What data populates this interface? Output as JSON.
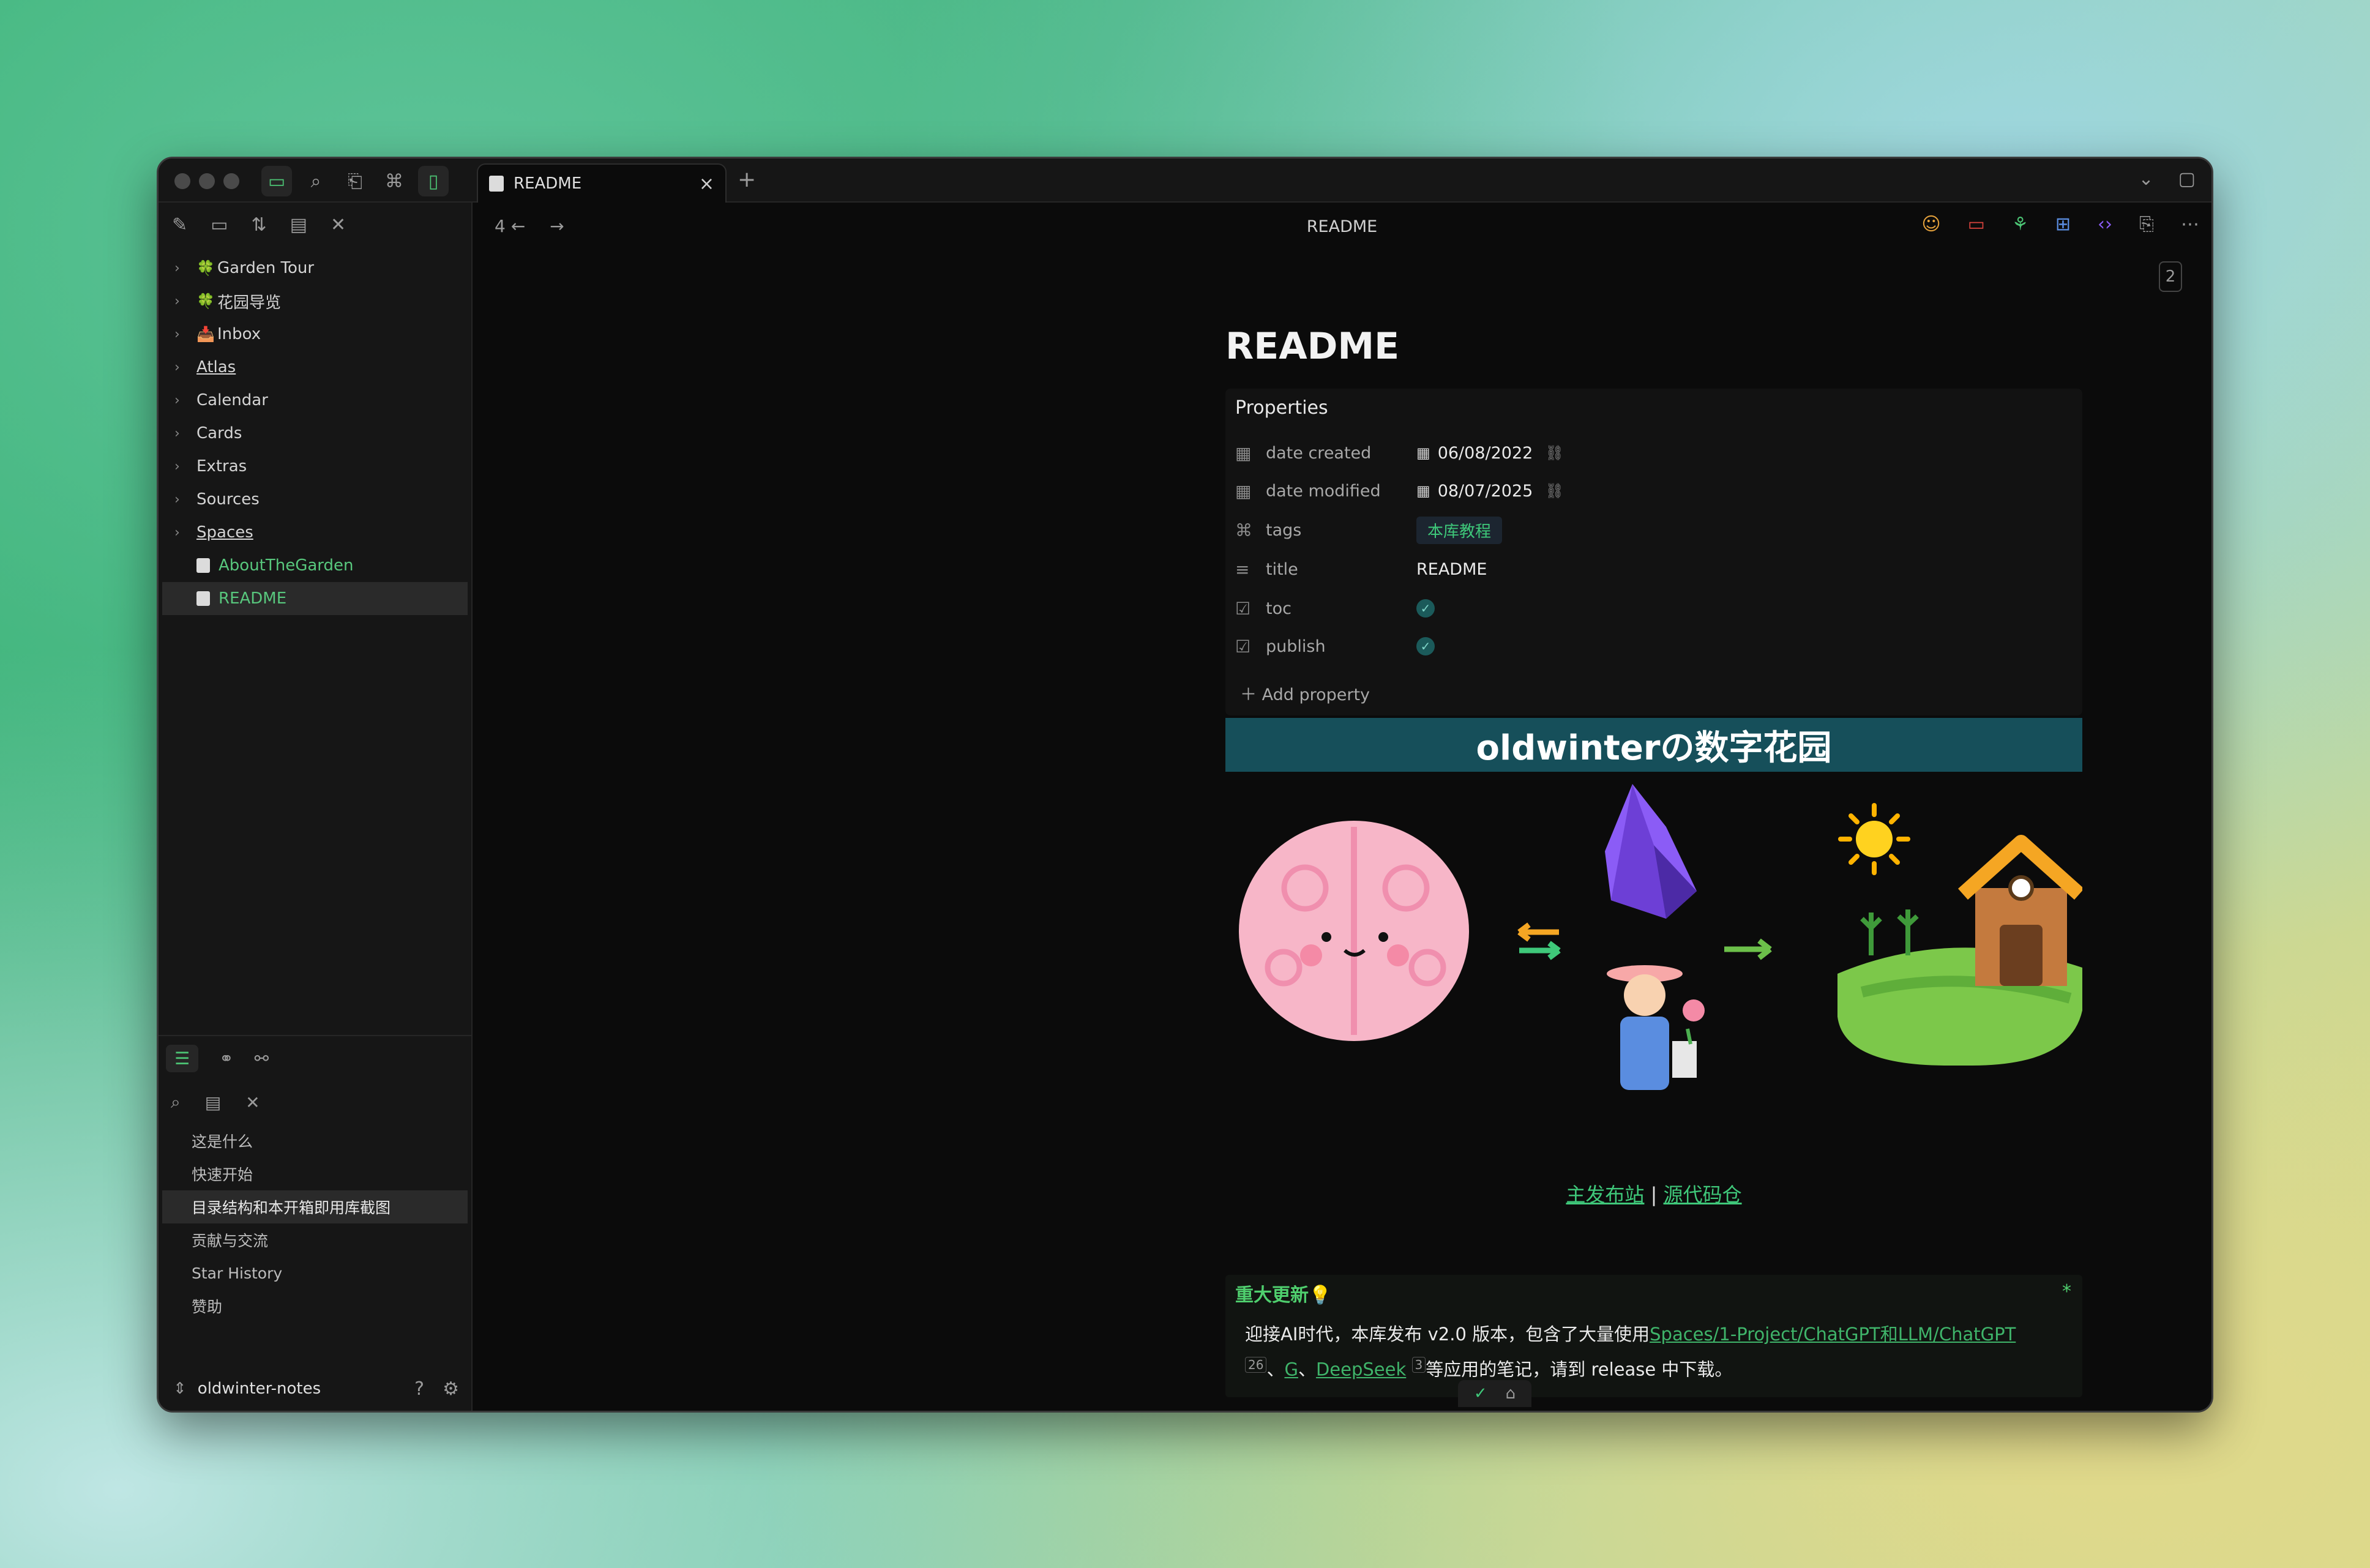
{
  "tab": {
    "label": "README"
  },
  "sidebar": {
    "tree": [
      {
        "label": "Garden Tour",
        "icon": "🍀",
        "folder": true,
        "underline": false
      },
      {
        "label": "花园导览",
        "icon": "🍀",
        "folder": true,
        "underline": false
      },
      {
        "label": "Inbox",
        "icon": "📥",
        "folder": true,
        "underline": false
      },
      {
        "label": "Atlas",
        "icon": "",
        "folder": true,
        "underline": true
      },
      {
        "label": "Calendar",
        "icon": "",
        "folder": true,
        "underline": false
      },
      {
        "label": "Cards",
        "icon": "",
        "folder": true,
        "underline": false
      },
      {
        "label": "Extras",
        "icon": "",
        "folder": true,
        "underline": false
      },
      {
        "label": "Sources",
        "icon": "",
        "folder": true,
        "underline": false
      },
      {
        "label": "Spaces",
        "icon": "",
        "folder": true,
        "underline": true
      },
      {
        "label": "AboutTheGarden",
        "icon": "",
        "folder": false,
        "underline": false
      },
      {
        "label": "README",
        "icon": "",
        "folder": false,
        "underline": false,
        "selected": true
      }
    ],
    "outline": [
      {
        "label": "这是什么"
      },
      {
        "label": "快速开始"
      },
      {
        "label": "目录结构和本开箱即用库截图",
        "selected": true
      },
      {
        "label": "贡献与交流"
      },
      {
        "label": "Star History"
      },
      {
        "label": "赞助"
      }
    ],
    "vault_name": "oldwinter-notes"
  },
  "nav": {
    "back_count": "4",
    "title": "README",
    "page_number": "2"
  },
  "note": {
    "title": "README",
    "properties_label": "Properties",
    "properties": {
      "date_created": {
        "key": "date created",
        "value": "06/08/2022"
      },
      "date_modified": {
        "key": "date modified",
        "value": "08/07/2025"
      },
      "tags": {
        "key": "tags",
        "value": "本库教程"
      },
      "title": {
        "key": "title",
        "value": "README"
      },
      "toc": {
        "key": "toc",
        "value": true
      },
      "publish": {
        "key": "publish",
        "value": true
      }
    },
    "add_property": "Add property",
    "banner": "oldwinterの数字花园",
    "links": {
      "site": "主发布站",
      "separator": "|",
      "repo": "源代码仓"
    },
    "callout": {
      "title": "重大更新💡",
      "text_1": "迎接AI时代，本库发布 v2.0 版本，包含了大量使用",
      "link_1": "Spaces/1-Project/ChatGPT和LLM/ChatGPT",
      "badge_1": "26",
      "sep_1": "、",
      "link_2": "G",
      "sep_2": "、",
      "link_3": "DeepSeek",
      "badge_3": "3",
      "text_2": "等应用的笔记，请到 release 中下载。"
    }
  },
  "colors": {
    "accent": "#4cc474",
    "banner": "#164f5a",
    "link": "#3fc87a"
  }
}
